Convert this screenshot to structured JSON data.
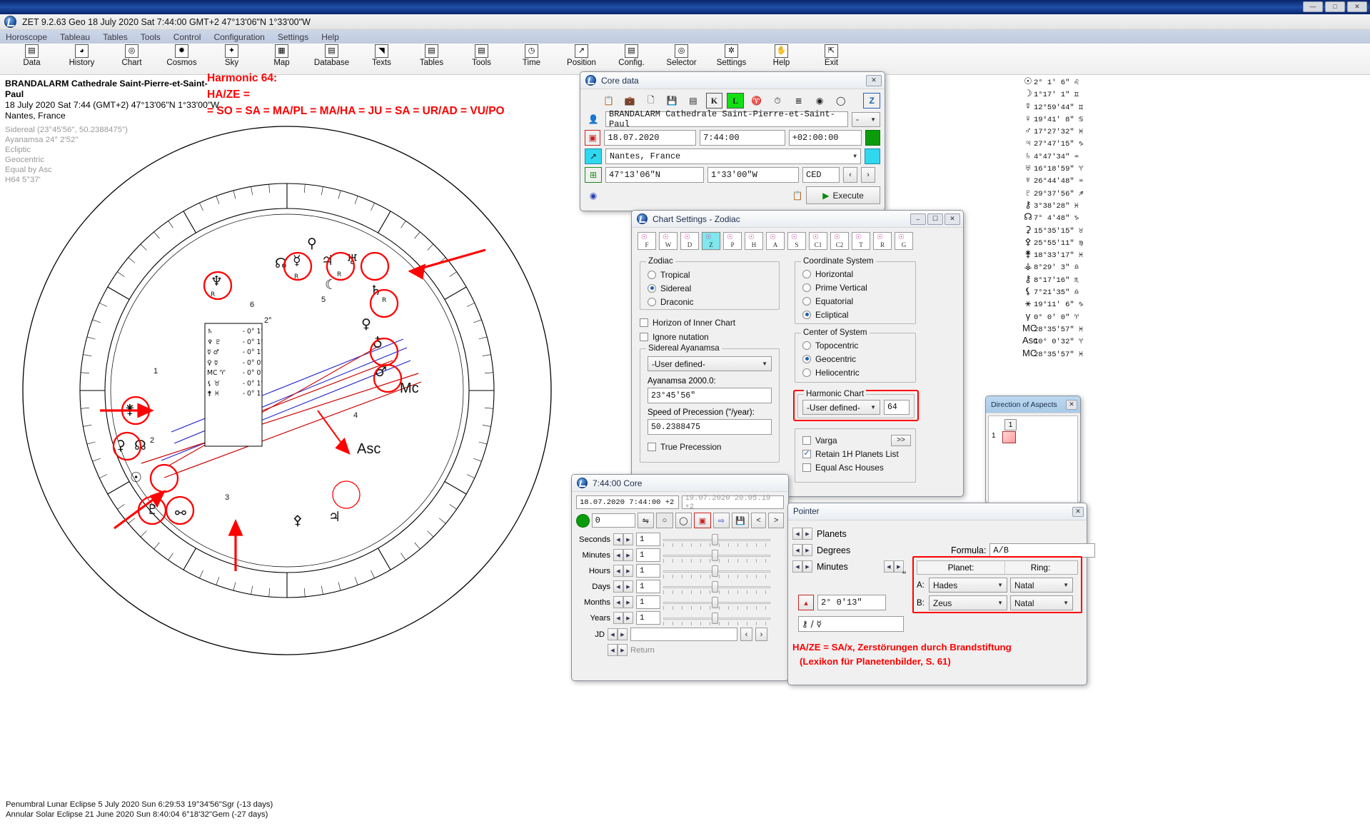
{
  "window": {
    "app_title": "ZET 9.2.63 Geo   18 July 2020  Sat   7:44:00 GMT+2 47°13'06\"N  1°33'00\"W",
    "minimize": "—",
    "maximize": "□",
    "close": "✕"
  },
  "menu": [
    "Horoscope",
    "Tableau",
    "Tables",
    "Tools",
    "Control",
    "Configuration",
    "Settings",
    "Help"
  ],
  "toolbar": [
    {
      "label": "Data",
      "icon": "grid-icon",
      "glyph": "▤"
    },
    {
      "label": "History",
      "icon": "clock-globe-icon",
      "glyph": "◕"
    },
    {
      "label": "Chart",
      "icon": "chart-wheel-icon",
      "glyph": "◎"
    },
    {
      "label": "Cosmos",
      "icon": "planet-icon",
      "glyph": "✹"
    },
    {
      "label": "Sky",
      "icon": "stars-icon",
      "glyph": "✦"
    },
    {
      "label": "Map",
      "icon": "map-icon",
      "glyph": "▦"
    },
    {
      "label": "Database",
      "icon": "database-icon",
      "glyph": "▤"
    },
    {
      "label": "Texts",
      "icon": "texts-icon",
      "glyph": "◥"
    },
    {
      "label": "Tables",
      "icon": "tables-icon",
      "glyph": "▤"
    },
    {
      "label": "Tools",
      "icon": "tools-icon",
      "glyph": "▤"
    },
    {
      "label": "Time",
      "icon": "time-icon",
      "glyph": "◷"
    },
    {
      "label": "Position",
      "icon": "position-icon",
      "glyph": "↗"
    },
    {
      "label": "Config.",
      "icon": "config-icon",
      "glyph": "▤"
    },
    {
      "label": "Selector",
      "icon": "selector-icon",
      "glyph": "◎"
    },
    {
      "label": "Settings",
      "icon": "settings-icon",
      "glyph": "✲"
    },
    {
      "label": "Help",
      "icon": "help-icon",
      "glyph": "✋"
    },
    {
      "label": "Exit",
      "icon": "exit-icon",
      "glyph": "⇱"
    }
  ],
  "chart_info": {
    "title": "BRANDALARM Cathedrale Saint-Pierre-et-Saint-Paul",
    "line2": "18 July 2020  Sat   7:44 (GMT+2) 47°13'06\"N  1°33'00\"W",
    "line3": "Nantes, France",
    "grey": [
      "Sidereal (23°45'56\", 50.2388475\")",
      "Ayanamsa 24° 2'52\"",
      "Ecliptic",
      "Geocentric",
      "Equal by Asc",
      "H64  5°37'"
    ]
  },
  "harmonic_note": {
    "line1": "Harmonic 64:",
    "line2": "HA/ZE =",
    "line3": "= SO = SA = MA/PL = MA/HA = JU = SA = UR/AD = VU/PO"
  },
  "eclipses": [
    "Penumbral Lunar Eclipse 5 July 2020 Sun  6:29:53 19°34'56\"Sgr (-13 days)",
    "Annular Solar Eclipse 21 June 2020 Sun  8:40:04  6°18'32\"Gem (-27 days)"
  ],
  "planet_list": [
    {
      "glyph": "☉",
      "text": "2°  1'  6\" ♌"
    },
    {
      "glyph": "☽",
      "text": "1°17'  1\" ♊"
    },
    {
      "glyph": "☿",
      "text": "12°59'44\" ♊"
    },
    {
      "glyph": "♀",
      "text": "19°41'  8\" ♋"
    },
    {
      "glyph": "♂",
      "text": "17°27'32\" ♓"
    },
    {
      "glyph": "♃",
      "text": "27°47'15\" ♑"
    },
    {
      "glyph": "♄",
      "text": "4°47'34\" ♒"
    },
    {
      "glyph": "♅",
      "text": "16°18'59\" ♈"
    },
    {
      "glyph": "♆",
      "text": "26°44'48\" ♒"
    },
    {
      "glyph": "♇",
      "text": "29°37'56\" ♐"
    },
    {
      "glyph": "⚷",
      "text": "3°38'28\" ♓"
    },
    {
      "glyph": "☊",
      "text": "7°  4'48\" ♑"
    },
    {
      "glyph": "⚳",
      "text": "15°35'15\" ♉"
    },
    {
      "glyph": "⚴",
      "text": "25°55'11\" ♍"
    },
    {
      "glyph": "⚵",
      "text": "18°33'17\" ♓"
    },
    {
      "glyph": "⚶",
      "text": "8°29' 3\" ♎"
    },
    {
      "glyph": "⚷",
      "text": "8°17'16\" ♏"
    },
    {
      "glyph": "⚸",
      "text": "7°21'35\" ♎"
    },
    {
      "glyph": "⚹",
      "text": "19°11'  6\" ♑"
    },
    {
      "glyph": "γ",
      "text": "0°  0'  0\" ♈"
    },
    {
      "glyph": "MC",
      "text": "28°35'57\" ♓"
    },
    {
      "glyph": "Asc",
      "text": "10°  0'32\" ♈"
    },
    {
      "glyph": "MC",
      "text": "28°35'57\" ♓"
    }
  ],
  "core_data": {
    "title": "Core data",
    "close": "✕",
    "toolbar_icons": [
      "copy-icon",
      "paste-icon",
      "new-icon",
      "save-icon",
      "calendar-icon",
      "K-icon",
      "L-icon",
      "zodiac-icon",
      "clock-icon",
      "sigma-icon",
      "gear-icon",
      "circle-icon",
      "Z-icon"
    ],
    "name": "BRANDALARM Cathedrale Saint-Pierre-et-Saint-Paul",
    "name_dropdown": "-",
    "date": "18.07.2020",
    "time": "7:44:00",
    "zone": "+02:00:00",
    "place": "Nantes, France",
    "latitude": "47°13'06\"N",
    "longitude": "1°33'00\"W",
    "country": "CED",
    "execute_label": "Execute",
    "nav_prev": "‹",
    "nav_next": "›"
  },
  "chart_settings": {
    "title": "Chart Settings - Zodiac",
    "tabs": [
      "F",
      "W",
      "D",
      "Z",
      "P",
      "H",
      "A",
      "S",
      "C1",
      "C2",
      "T",
      "R",
      "G"
    ],
    "active_tab_index": 3,
    "zodiac": {
      "legend": "Zodiac",
      "options": [
        "Tropical",
        "Sidereal",
        "Draconic"
      ],
      "selected": "Sidereal"
    },
    "checkboxes": [
      {
        "label": "Horizon of Inner Chart",
        "checked": false
      },
      {
        "label": "Ignore nutation",
        "checked": false
      }
    ],
    "ayanamsa": {
      "legend": "Sidereal Ayanamsa",
      "select": "-User defined-",
      "label_2000": "Ayanamsa 2000.0:",
      "value_2000": "23°45'56\"",
      "label_speed": "Speed of Precession (\"/year):",
      "value_speed": "50.2388475",
      "true_precession": {
        "label": "True Precession",
        "checked": false
      }
    },
    "coordinate_system": {
      "legend": "Coordinate System",
      "options": [
        "Horizontal",
        "Prime Vertical",
        "Equatorial",
        "Ecliptical"
      ],
      "selected": "Ecliptical"
    },
    "center_of_system": {
      "legend": "Center of System",
      "options": [
        "Topocentric",
        "Geocentric",
        "Heliocentric"
      ],
      "selected": "Geocentric"
    },
    "harmonic_chart": {
      "legend": "Harmonic Chart",
      "select": "-User defined-",
      "value": "64",
      "highlighted": true
    },
    "varga": {
      "label": "Varga",
      "checked": false
    },
    "varga_btn": ">>",
    "retain": {
      "label": "Retain 1H Planets List",
      "checked": true
    },
    "equal_asc": {
      "label": "Equal Asc Houses",
      "checked": false
    }
  },
  "direction_of_aspects": {
    "title": "Direction of Aspects",
    "close": "✕",
    "cell_top": "1",
    "cell_left": "1"
  },
  "time_window": {
    "title": "7:44:00 Core",
    "date_left": "18.07.2020  7:44:00 +2",
    "date_right": "19.07.2020  20.05.19 +2",
    "value": "0",
    "buttons": [
      "swap-icon",
      "small-circle-icon",
      "big-circle-icon",
      "clock-icon",
      "export-icon",
      "save-icon",
      "<",
      ">"
    ],
    "rows": [
      {
        "label": "Seconds",
        "value": "1"
      },
      {
        "label": "Minutes",
        "value": "1"
      },
      {
        "label": "Hours",
        "value": "1"
      },
      {
        "label": "Days",
        "value": "1"
      },
      {
        "label": "Months",
        "value": "1"
      },
      {
        "label": "Years",
        "value": "1"
      }
    ],
    "jd_label": "JD",
    "jd_value": "",
    "return_label": "Return",
    "nav_prev": "‹",
    "nav_next": "›"
  },
  "pointer": {
    "title": "Pointer",
    "close": "✕",
    "rows": [
      "Planets",
      "Degrees",
      "Minutes"
    ],
    "formula_label": "Formula:",
    "formula_value": "A/B",
    "quote": "\"",
    "coord_value": "2°  0'13\"",
    "expr": "⚷ / ☿",
    "table": {
      "col_planet": "Planet:",
      "col_ring": "Ring:",
      "rows": [
        {
          "key": "A:",
          "planet": "Hades",
          "ring": "Natal"
        },
        {
          "key": "B:",
          "planet": "Zeus",
          "ring": "Natal"
        }
      ]
    },
    "note_line1": "HA/ZE = SA/x, Zerstörungen durch Brandstiftung",
    "note_line2": "(Lexikon für Planetenbilder, S. 61)"
  },
  "wheel": {
    "asc_label": "Asc",
    "mc_label": "Mc",
    "house_numbers": [
      "2°",
      "1",
      "2",
      "3",
      "4",
      "5",
      "6"
    ],
    "inner_table": [
      {
        "glyph": "♄",
        "text": "- 0° 1'"
      },
      {
        "glyph": "♆ ♇",
        "text": "- 0° 1'"
      },
      {
        "glyph": "☿ ♂",
        "text": "- 0° 1'"
      },
      {
        "glyph": "♀ ☿",
        "text": "- 0° 0'"
      },
      {
        "glyph": "MC ♈",
        "text": "- 0° 0'"
      },
      {
        "glyph": "⚸ ♉",
        "text": "- 0° 1'"
      },
      {
        "glyph": "⚵ ♓",
        "text": "- 0° 1'"
      }
    ]
  },
  "colors": {
    "accent_red": "#ff0000",
    "title_blue": "#0a246a",
    "link_blue": "#1a5fb4",
    "chart_blue": "#2222cc",
    "grey_text": "#9a9a9a"
  }
}
